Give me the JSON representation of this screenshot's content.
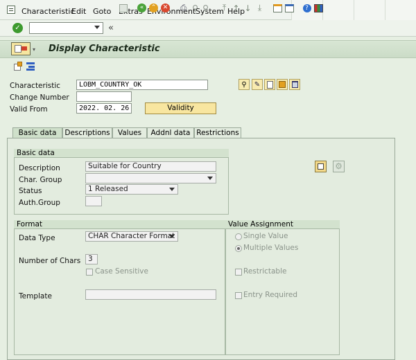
{
  "menu": {
    "items": [
      {
        "label": "Characteristic"
      },
      {
        "label": "Edit"
      },
      {
        "label": "Goto"
      },
      {
        "label": "Extras"
      },
      {
        "label": "Environment"
      },
      {
        "label": "System"
      },
      {
        "label": "Help"
      }
    ]
  },
  "toolbar": {
    "command_field_value": ""
  },
  "title": "Display Characteristic",
  "header": {
    "characteristic_label": "Characteristic",
    "characteristic_value": "LOBM_COUNTRY_OK",
    "change_number_label": "Change Number",
    "change_number_value": "",
    "valid_from_label": "Valid From",
    "valid_from_value": "2022. 02. 26",
    "validity_button": "Validity"
  },
  "tabs": [
    {
      "label": "Basic data"
    },
    {
      "label": "Descriptions"
    },
    {
      "label": "Values"
    },
    {
      "label": "Addnl data"
    },
    {
      "label": "Restrictions"
    }
  ],
  "basic_data": {
    "group_title": "Basic data",
    "description_label": "Description",
    "description_value": "Suitable for Country",
    "char_group_label": "Char. Group",
    "char_group_value": "",
    "status_label": "Status",
    "status_value": "1 Released",
    "auth_group_label": "Auth.Group",
    "auth_group_value": ""
  },
  "format": {
    "group_title": "Format",
    "data_type_label": "Data Type",
    "data_type_value": "CHAR Character Format",
    "num_chars_label": "Number of Chars",
    "num_chars_value": "3",
    "case_sensitive_label": "Case Sensitive",
    "template_label": "Template",
    "template_value": ""
  },
  "value_assignment": {
    "group_title": "Value Assignment",
    "single_value_label": "Single Value",
    "multiple_values_label": "Multiple Values",
    "restrictable_label": "Restrictable",
    "entry_required_label": "Entry Required"
  }
}
